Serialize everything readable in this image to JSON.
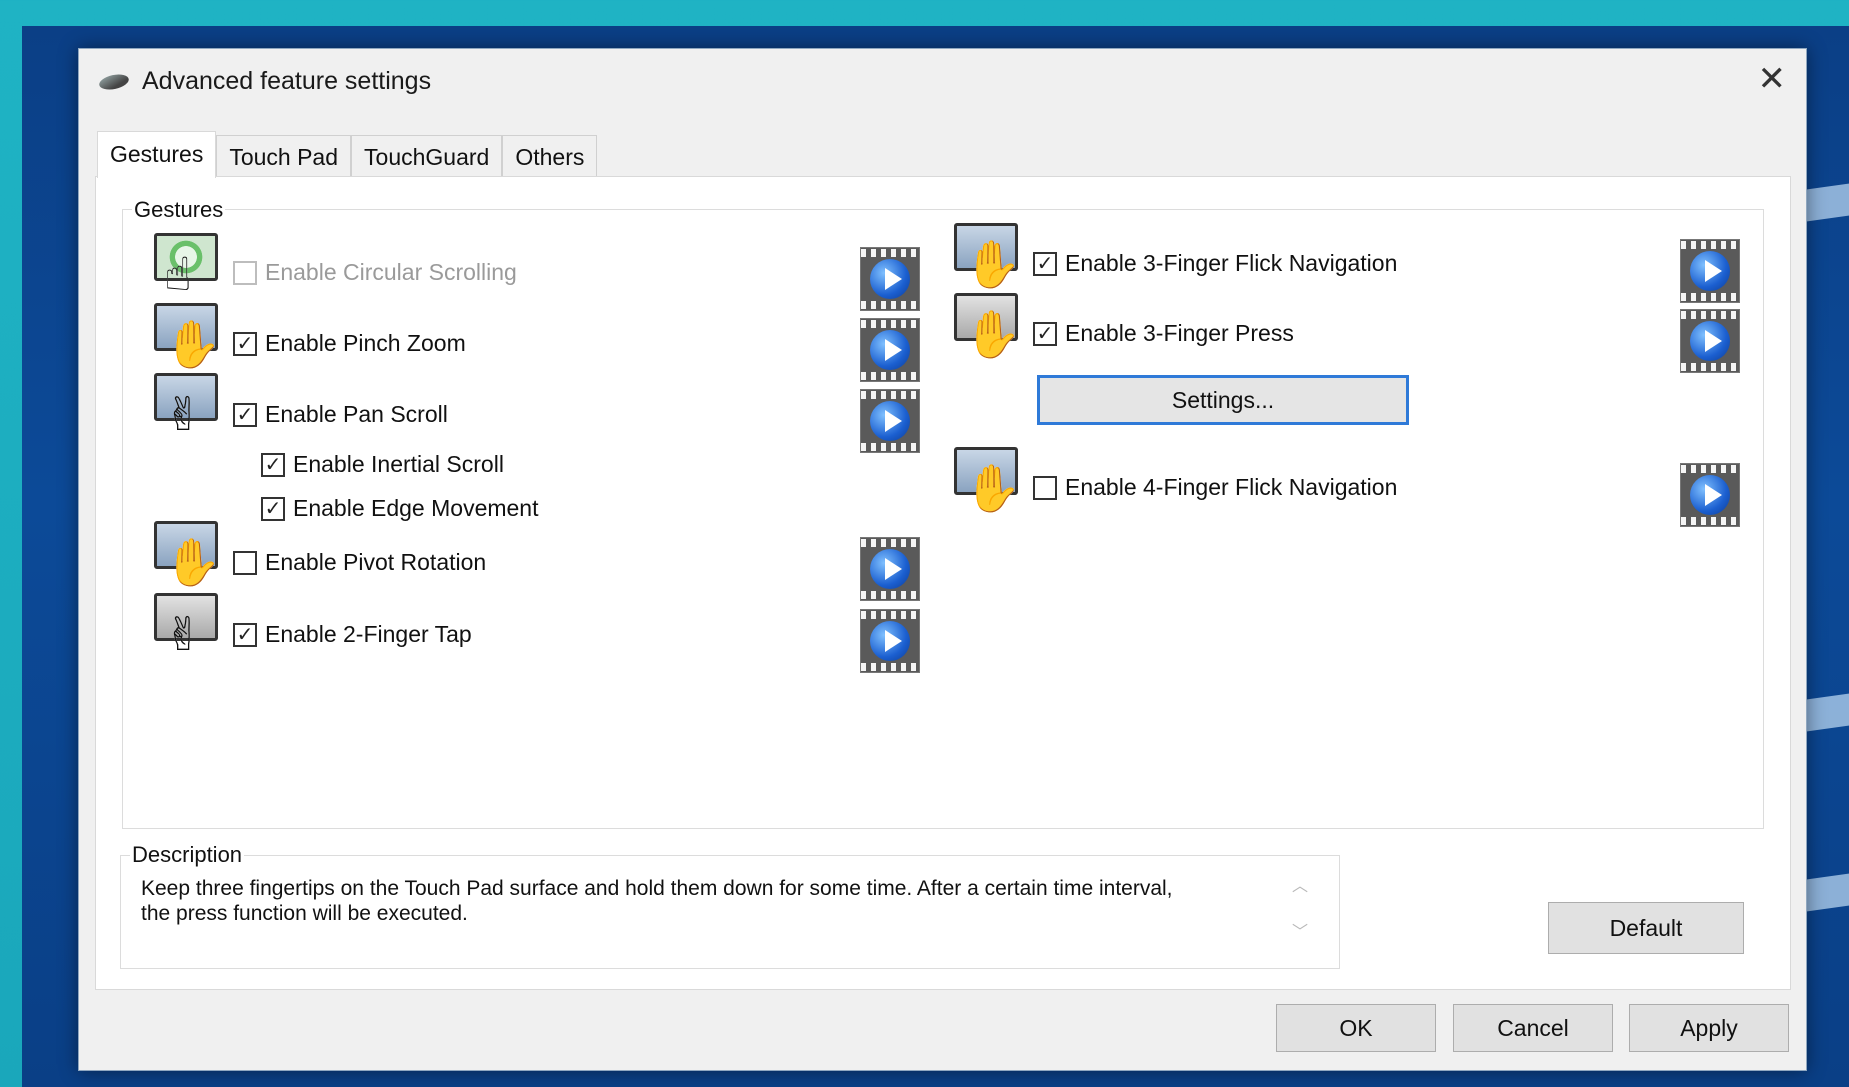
{
  "window": {
    "title": "Advanced feature settings",
    "close_label": "✕"
  },
  "tabs": [
    "Gestures",
    "Touch Pad",
    "TouchGuard",
    "Others"
  ],
  "gestures_group": {
    "label": "Gestures",
    "left": [
      {
        "label": "Enable Circular Scrolling",
        "checked": false,
        "disabled": true
      },
      {
        "label": "Enable Pinch Zoom",
        "checked": true
      },
      {
        "label": "Enable Pan Scroll",
        "checked": true
      },
      {
        "label": "Enable Inertial Scroll",
        "checked": true
      },
      {
        "label": "Enable Edge Movement",
        "checked": true
      },
      {
        "label": "Enable Pivot Rotation",
        "checked": false
      },
      {
        "label": "Enable 2-Finger Tap",
        "checked": true
      }
    ],
    "right": [
      {
        "label": "Enable 3-Finger Flick Navigation",
        "checked": true
      },
      {
        "label": "Enable 3-Finger Press",
        "checked": true
      },
      {
        "label": "Enable 4-Finger Flick Navigation",
        "checked": false
      }
    ],
    "settings_button": "Settings..."
  },
  "description": {
    "label": "Description",
    "text": "Keep three fingertips on the Touch Pad surface and hold them down for some time. After a certain time interval, the press function will be executed."
  },
  "buttons": {
    "default": "Default",
    "ok": "OK",
    "cancel": "Cancel",
    "apply": "Apply"
  },
  "check_mark": "✓"
}
